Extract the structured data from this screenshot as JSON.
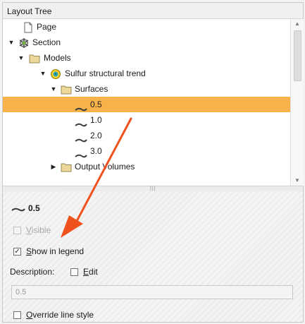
{
  "panel": {
    "title": "Layout Tree"
  },
  "tree": {
    "items": [
      {
        "label": "Page"
      },
      {
        "label": "Section"
      },
      {
        "label": "Models"
      },
      {
        "label": "Sulfur structural trend"
      },
      {
        "label": "Surfaces"
      },
      {
        "label": "0.5"
      },
      {
        "label": "1.0"
      },
      {
        "label": "2.0"
      },
      {
        "label": "3.0"
      },
      {
        "label": "Output Volumes"
      }
    ]
  },
  "properties": {
    "title": "0.5",
    "visible": {
      "first": "V",
      "rest": "isible",
      "checked": false,
      "enabled": false
    },
    "legend": {
      "first": "S",
      "rest": "how in legend",
      "checked": true,
      "check_glyph": "✓"
    },
    "description_label": "Description:",
    "edit": {
      "first": "E",
      "rest": "dit",
      "checked": false
    },
    "description_value": "0.5",
    "override": {
      "first": "O",
      "rest": "verride line style",
      "checked": false
    }
  },
  "colors": {
    "selection": "#f7b24a",
    "annotation_arrow": "#f0521e",
    "folder": "#ecd99a",
    "model_icon": "#f2cf1f"
  },
  "icons": [
    "page-icon",
    "section-icon",
    "folder-icon",
    "model-icon",
    "surface-line-icon",
    "scroll-up-icon",
    "scroll-down-icon",
    "splitter-grip-icon"
  ]
}
